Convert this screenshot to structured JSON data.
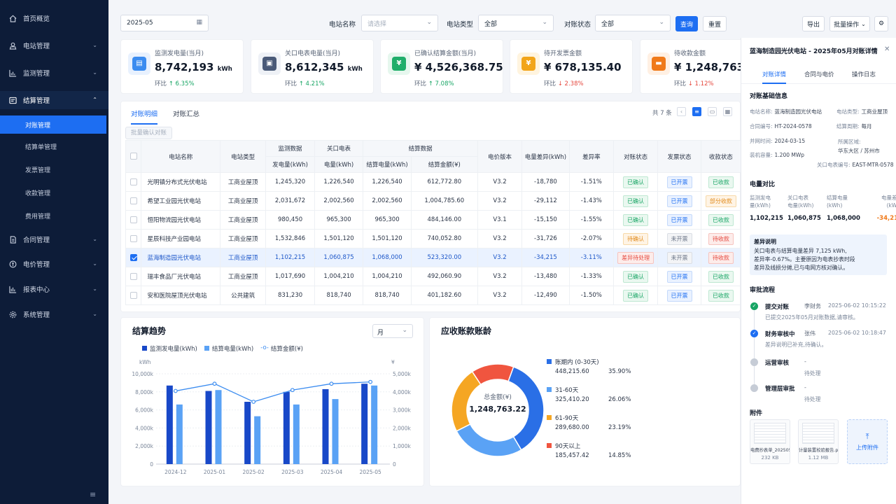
{
  "sidebar": {
    "items": [
      {
        "label": "首页概览",
        "icon": "home-icon"
      },
      {
        "label": "电站管理",
        "icon": "plant-icon"
      },
      {
        "label": "监测管理",
        "icon": "monitor-icon"
      },
      {
        "label": "结算管理",
        "icon": "settlement-icon"
      },
      {
        "label": "合同管理",
        "icon": "contract-icon"
      },
      {
        "label": "电价管理",
        "icon": "price-icon"
      },
      {
        "label": "报表中心",
        "icon": "report-icon"
      },
      {
        "label": "系统管理",
        "icon": "settings-icon"
      }
    ],
    "sub": [
      "对账管理",
      "结算单管理",
      "发票管理",
      "收款管理",
      "费用管理"
    ]
  },
  "filters": {
    "month": "2025-05",
    "station_label": "电站名称",
    "station_placeholder": "请选择",
    "type_label": "电站类型",
    "type_value": "全部",
    "status_label": "对账状态",
    "status_value": "全部",
    "query": "查询",
    "reset": "重置",
    "export": "导出",
    "batch": "批量操作"
  },
  "kpis": [
    {
      "title": "监测发电量(当月)",
      "value": "8,742,193",
      "unit": "kWh",
      "change_label": "环比",
      "change": "6.35%",
      "dir": "up",
      "color": "#3b8cf0",
      "bg": "#e8f1fe"
    },
    {
      "title": "关口电表电量(当月)",
      "value": "8,612,345",
      "unit": "kWh",
      "change_label": "环比",
      "change": "4.21%",
      "dir": "up",
      "color": "#4a5a78",
      "bg": "#eef1f6"
    },
    {
      "title": "已确认结算金额(当月)",
      "value": "¥ 4,526,368.75",
      "unit": "",
      "change_label": "环比",
      "change": "7.08%",
      "dir": "up",
      "color": "#1fae6a",
      "bg": "#e6f7ee"
    },
    {
      "title": "待开发票金额",
      "value": "¥ 678,135.40",
      "unit": "",
      "change_label": "环比",
      "change": "2.38%",
      "dir": "down",
      "color": "#f2a51a",
      "bg": "#fff4df"
    },
    {
      "title": "待收款金额",
      "value": "¥ 1,248,763.22",
      "unit": "",
      "change_label": "环比",
      "change": "1.12%",
      "dir": "down",
      "color": "#f07a1a",
      "bg": "#fff0e3"
    }
  ],
  "table": {
    "tabs": [
      "对账明细",
      "对账汇总"
    ],
    "total": "共 7 条",
    "batch_confirm": "批量确认对账",
    "headers": {
      "name": "电站名称",
      "type": "电站类型",
      "monitor": "监测数据",
      "gate": "关口电表",
      "settle": "结算数据",
      "gen": "发电量(kWh)",
      "elec": "电量(kWh)",
      "settle_e": "结算电量(kWh)",
      "settle_m": "结算金额(¥)",
      "price": "电价版本",
      "diff": "电量差异(kWh)",
      "rate": "差异率",
      "rec": "对账状态",
      "inv": "发票状态",
      "col": "收款状态"
    },
    "rows": [
      [
        "光明镇分布式光伏电站",
        "工商业屋顶",
        "1,245,320",
        "1,226,540",
        "1,226,540",
        "612,772.80",
        "V3.2",
        "-18,780",
        "-1.51%",
        "已确认",
        "已开票",
        "已收款"
      ],
      [
        "希望工业园光伏电站",
        "工商业屋顶",
        "2,031,672",
        "2,002,560",
        "2,002,560",
        "1,004,785.60",
        "V3.2",
        "-29,112",
        "-1.43%",
        "已确认",
        "已开票",
        "部分收款"
      ],
      [
        "恒阳物流园光伏电站",
        "工商业屋顶",
        "980,450",
        "965,300",
        "965,300",
        "484,146.00",
        "V3.1",
        "-15,150",
        "-1.55%",
        "已确认",
        "已开票",
        "已收款"
      ],
      [
        "星辰科技产业园电站",
        "工商业屋顶",
        "1,532,846",
        "1,501,120",
        "1,501,120",
        "740,052.80",
        "V3.2",
        "-31,726",
        "-2.07%",
        "待确认",
        "未开票",
        "待收款"
      ],
      [
        "蓝海制造园光伏电站",
        "工商业屋顶",
        "1,102,215",
        "1,060,875",
        "1,068,000",
        "523,320.00",
        "V3.2",
        "-34,215",
        "-3.11%",
        "差异待处理",
        "未开票",
        "待收款"
      ],
      [
        "瑞丰食品厂光伏电站",
        "工商业屋顶",
        "1,017,690",
        "1,004,210",
        "1,004,210",
        "492,060.90",
        "V3.2",
        "-13,480",
        "-1.33%",
        "已确认",
        "已开票",
        "已收款"
      ],
      [
        "安和医院屋顶光伏电站",
        "公共建筑",
        "831,230",
        "818,740",
        "818,740",
        "401,182.60",
        "V3.2",
        "-12,490",
        "-1.50%",
        "已确认",
        "已开票",
        "已收款"
      ]
    ]
  },
  "trend": {
    "title": "结算趋势",
    "period": "月",
    "legend": [
      "监测发电量(kWh)",
      "结算电量(kWh)",
      "结算金额(¥)"
    ],
    "yunit_left": "kWh",
    "yunit_right": "¥"
  },
  "chart_data": [
    {
      "type": "bar",
      "title": "结算趋势",
      "categories": [
        "2024-12",
        "2025-01",
        "2025-02",
        "2025-03",
        "2025-04",
        "2025-05"
      ],
      "series": [
        {
          "name": "监测发电量(kWh)",
          "values": [
            8700,
            8100,
            6900,
            8000,
            8300,
            8900
          ]
        },
        {
          "name": "结算电量(kWh)",
          "values": [
            6600,
            8200,
            5300,
            6600,
            7200,
            8700
          ]
        },
        {
          "name": "结算金额(¥)",
          "values": [
            4050,
            4450,
            3450,
            4100,
            4450,
            4550
          ]
        }
      ],
      "y_left_ticks": [
        "0",
        "2,000k",
        "4,000k",
        "6,000k",
        "8,000k",
        "10,000k"
      ],
      "y_right_ticks": [
        "0",
        "1,000k",
        "2,000k",
        "3,000k",
        "4,000k",
        "5,000k"
      ],
      "ylim": [
        0,
        10000
      ]
    },
    {
      "type": "pie",
      "title": "应收账款账龄",
      "center_label": "总金额(¥)",
      "center_value": "1,248,763.22",
      "categories": [
        "账期内 (0-30天)",
        "31-60天",
        "61-90天",
        "90天以上"
      ],
      "amounts": [
        "448,215.60",
        "325,410.20",
        "289,680.00",
        "185,457.42"
      ],
      "percents": [
        "35.90%",
        "26.06%",
        "23.19%",
        "14.85%"
      ],
      "values": [
        35.9,
        26.06,
        23.19,
        14.85
      ],
      "colors": [
        "#2a6fe6",
        "#5aa2f5",
        "#f5a623",
        "#f0553f"
      ]
    }
  ],
  "aging": {
    "title": "应收账款账龄"
  },
  "panel": {
    "title": "蓝海制造园光伏电站 - 2025年05月对账详情",
    "tabs": [
      "对账详情",
      "合同与电价",
      "操作日志"
    ],
    "basic_title": "对账基础信息",
    "basic": [
      [
        "电站名称:",
        "蓝海制造园光伏电站"
      ],
      [
        "电站类型:",
        "工商业屋顶"
      ],
      [
        "合同编号:",
        "HT-2024-0578"
      ],
      [
        "结算周期:",
        "每月"
      ],
      [
        "并网时间:",
        "2024-03-15"
      ],
      [
        "所属区域:",
        "华东大区 / 苏州市"
      ],
      [
        "装机容量:",
        "1.200 MWp"
      ],
      [
        "关口电表编号:",
        "EAST-MTR-0578"
      ]
    ],
    "compare_title": "电量对比",
    "compare": [
      {
        "label1": "监测发电",
        "label2": "量(kWh)",
        "value": "1,102,215"
      },
      {
        "label1": "关口电表",
        "label2": "电量(kWh)",
        "value": "1,060,875"
      },
      {
        "label1": "结算电量",
        "label2": "(kWh)",
        "value": "1,068,000"
      },
      {
        "label1": "电量差异",
        "label2": "(kWh)",
        "value": "-34,215"
      }
    ],
    "diff_title": "差异说明",
    "diff_text": [
      "关口电表与结算电量差异 7,125 kWh,",
      "差异率-0.67%。主要原因为电表抄表时段",
      "差异及线损分摊,已与电网方核对确认。"
    ],
    "approval_title": "审批流程",
    "steps": [
      {
        "name": "提交对账",
        "user": "李财务",
        "time": "2025-06-02 10:15:22",
        "note": "已提交2025年05月对账数据,请审核。",
        "state": "done"
      },
      {
        "name": "财务审核中",
        "user": "张伟",
        "time": "2025-06-02 10:18:47",
        "note": "差异说明已补充,待确认。",
        "state": "current"
      },
      {
        "name": "运营审核",
        "user": "-",
        "time": "",
        "note": "待处理",
        "state": "pending"
      },
      {
        "name": "管理层审批",
        "user": "-",
        "time": "",
        "note": "待处理",
        "state": "pending"
      }
    ],
    "attach_title": "附件",
    "files": [
      {
        "name": "电费抄表单_202505.pdf",
        "size": "232 KB"
      },
      {
        "name": "计量装置校验报告.pdf",
        "size": "1.12 MB"
      }
    ],
    "upload": "上传附件"
  }
}
